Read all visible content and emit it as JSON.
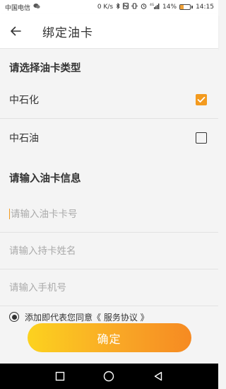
{
  "status_bar": {
    "carrier": "中国电信",
    "speed": "0 K/s",
    "signal_label": "4G",
    "battery_percent": "14%",
    "battery_level": 0.14,
    "time": "14:15"
  },
  "header": {
    "title": "绑定油卡"
  },
  "card_type": {
    "section_title": "请选择油卡类型",
    "options": [
      {
        "label": "中石化",
        "checked": true
      },
      {
        "label": "中石油",
        "checked": false
      }
    ]
  },
  "card_info": {
    "section_title": "请输入油卡信息",
    "fields": [
      {
        "placeholder": "请输入油卡卡号",
        "value": ""
      },
      {
        "placeholder": "请输入持卡姓名",
        "value": ""
      },
      {
        "placeholder": "请输入手机号",
        "value": ""
      }
    ]
  },
  "agreement": {
    "text": "添加即代表您同意《 服务协议 》",
    "selected": true
  },
  "confirm": {
    "label": "确定"
  },
  "colors": {
    "accent": "#f39a1e",
    "button_start": "#fcd21f",
    "button_end": "#f68a22"
  },
  "icons": [
    "back-arrow-icon",
    "checkbox-checked-icon",
    "checkbox-empty-icon",
    "radio-selected-icon",
    "nav-recents-icon",
    "nav-home-icon",
    "nav-back-icon"
  ]
}
